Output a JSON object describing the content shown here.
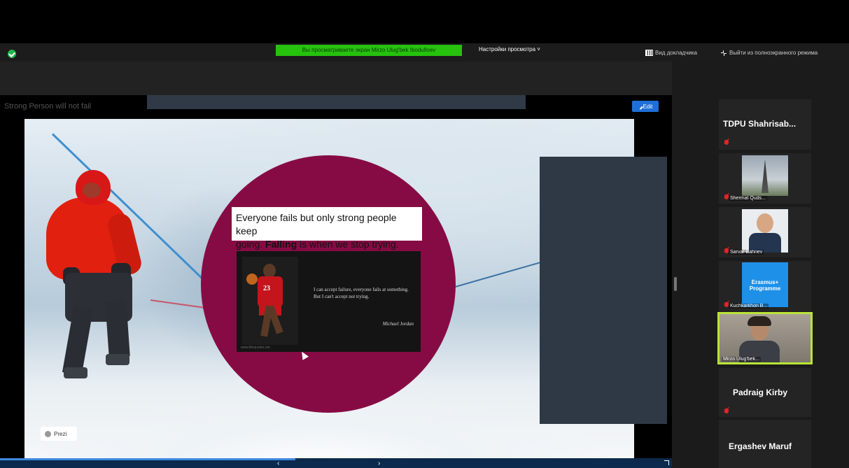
{
  "topbar": {
    "banner_text": "Вы просматриваете экран Mirzo Ulug'bek Ibodulloev",
    "view_options_label": "Настройки просмотра ˅",
    "speaker_view_label": "Вид докладчика",
    "exit_fullscreen_label": "Выйти из полноэкранного режима"
  },
  "presentation": {
    "title": "Strong Person will not fail",
    "edit_label": "Edit",
    "quote_line_1": "Everyone fails but only strong people keep",
    "quote_line_2_pre": "going. ",
    "quote_bold": "Falling",
    "quote_line_2_post": " is when we stop trying.",
    "jersey_number": "23",
    "inner_quote": "I can accept failure, everyone fails at something. But I can't accept not trying.",
    "inner_author": "Michael Jordan",
    "inner_watermark": "www.lifequotes.net",
    "prezi_label": "Prezi"
  },
  "nav": {
    "prev": "‹",
    "next": "›"
  },
  "participants": [
    {
      "name": "TDPU  Shahrisab...",
      "type": "name-only"
    },
    {
      "name": "Shermat Quds...",
      "type": "photo",
      "image": "eiffel-tower"
    },
    {
      "name": "Sarvar Bahriev",
      "type": "photo",
      "image": "man-portrait"
    },
    {
      "name": "Kuchkarkhon B...",
      "type": "photo",
      "image": "erasmus-logo",
      "image_text": "Erasmus+ Programme"
    },
    {
      "name": "Mirzo Ulug'bek...",
      "type": "video",
      "active": true
    },
    {
      "name": "Padraig Kirby",
      "type": "name-only"
    },
    {
      "name": "Ergashev Maruf",
      "type": "name-only"
    }
  ],
  "colors": {
    "circle": "#860b44",
    "banner": "#26c20e",
    "active_speaker": "#b9e437",
    "edit_button": "#1f6fd8"
  }
}
